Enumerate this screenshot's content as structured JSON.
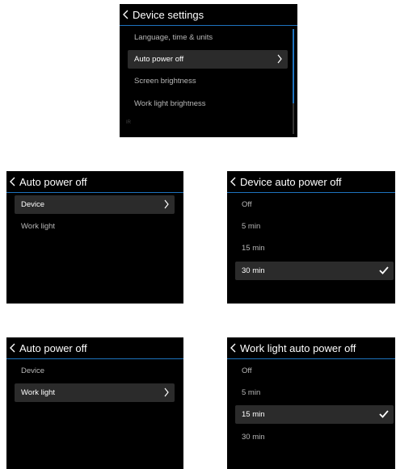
{
  "screen1": {
    "title": "Device settings",
    "items": [
      {
        "label": "Language, time & units"
      },
      {
        "label": "Auto power off"
      },
      {
        "label": "Screen brightness"
      },
      {
        "label": "Work light brightness"
      }
    ],
    "partial_label": "IR"
  },
  "screen2": {
    "title": "Auto power off",
    "items": [
      {
        "label": "Device"
      },
      {
        "label": "Work light"
      }
    ]
  },
  "screen3": {
    "title": "Device auto power off",
    "items": [
      {
        "label": "Off"
      },
      {
        "label": "5 min"
      },
      {
        "label": "15 min"
      },
      {
        "label": "30 min"
      }
    ]
  },
  "screen4": {
    "title": "Auto power off",
    "items": [
      {
        "label": "Device"
      },
      {
        "label": "Work light"
      }
    ]
  },
  "screen5": {
    "title": "Work light auto power off",
    "items": [
      {
        "label": "Off"
      },
      {
        "label": "5 min"
      },
      {
        "label": "15 min"
      },
      {
        "label": "30 min"
      }
    ]
  },
  "icons": {
    "back": "chevron-left-icon",
    "next": "chevron-right-icon",
    "selected": "checkmark-icon"
  },
  "colors": {
    "screen_bg": "#000000",
    "accent": "#1e73be",
    "selected_row": "#2b2b2b",
    "text_primary": "#ffffff",
    "text_secondary": "#b8b8b8"
  }
}
